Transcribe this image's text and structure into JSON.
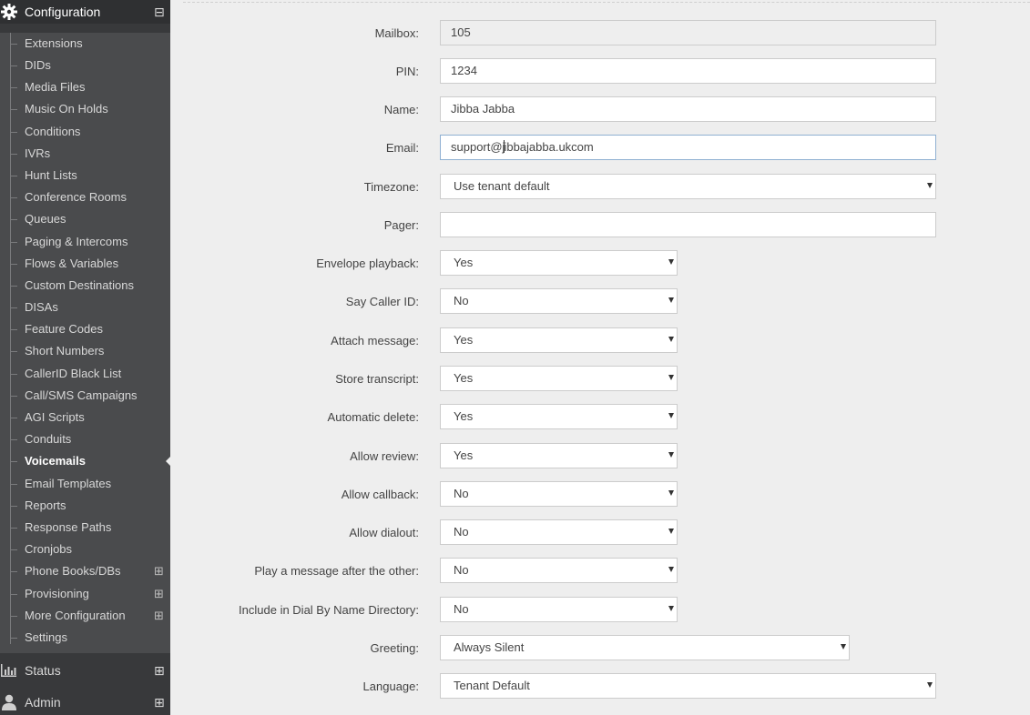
{
  "sidebar": {
    "configuration": {
      "label": "Configuration",
      "toggle": "⊟"
    },
    "items": [
      {
        "label": "Extensions"
      },
      {
        "label": "DIDs"
      },
      {
        "label": "Media Files"
      },
      {
        "label": "Music On Holds"
      },
      {
        "label": "Conditions"
      },
      {
        "label": "IVRs"
      },
      {
        "label": "Hunt Lists"
      },
      {
        "label": "Conference Rooms"
      },
      {
        "label": "Queues"
      },
      {
        "label": "Paging & Intercoms"
      },
      {
        "label": "Flows & Variables"
      },
      {
        "label": "Custom Destinations"
      },
      {
        "label": "DISAs"
      },
      {
        "label": "Feature Codes"
      },
      {
        "label": "Short Numbers"
      },
      {
        "label": "CallerID Black List"
      },
      {
        "label": "Call/SMS Campaigns"
      },
      {
        "label": "AGI Scripts"
      },
      {
        "label": "Conduits"
      },
      {
        "label": "Voicemails",
        "active": true
      },
      {
        "label": "Email Templates"
      },
      {
        "label": "Reports"
      },
      {
        "label": "Response Paths"
      },
      {
        "label": "Cronjobs"
      },
      {
        "label": "Phone Books/DBs",
        "expand": "⊞"
      },
      {
        "label": "Provisioning",
        "expand": "⊞"
      },
      {
        "label": "More Configuration",
        "expand": "⊞"
      },
      {
        "label": "Settings"
      }
    ],
    "status": {
      "label": "Status",
      "toggle": "⊞"
    },
    "admin": {
      "label": "Admin",
      "toggle": "⊞"
    }
  },
  "form": {
    "mailbox": {
      "label": "Mailbox:",
      "value": "105"
    },
    "pin": {
      "label": "PIN:",
      "value": "1234"
    },
    "name": {
      "label": "Name:",
      "value": "Jibba Jabba"
    },
    "email": {
      "label": "Email:",
      "value_before": "support@j",
      "value_after": "ibbajabba.ukcom"
    },
    "timezone": {
      "label": "Timezone:",
      "value": "Use tenant default"
    },
    "pager": {
      "label": "Pager:",
      "value": ""
    },
    "envelope_playback": {
      "label": "Envelope playback:",
      "value": "Yes"
    },
    "say_caller_id": {
      "label": "Say Caller ID:",
      "value": "No"
    },
    "attach_message": {
      "label": "Attach message:",
      "value": "Yes"
    },
    "store_transcript": {
      "label": "Store transcript:",
      "value": "Yes"
    },
    "automatic_delete": {
      "label": "Automatic delete:",
      "value": "Yes"
    },
    "allow_review": {
      "label": "Allow review:",
      "value": "Yes"
    },
    "allow_callback": {
      "label": "Allow callback:",
      "value": "No"
    },
    "allow_dialout": {
      "label": "Allow dialout:",
      "value": "No"
    },
    "play_after_other": {
      "label": "Play a message after the other:",
      "value": "No"
    },
    "dial_by_name": {
      "label": "Include in Dial By Name Directory:",
      "value": "No"
    },
    "greeting": {
      "label": "Greeting:",
      "value": "Always Silent"
    },
    "language": {
      "label": "Language:",
      "value": "Tenant Default"
    }
  }
}
